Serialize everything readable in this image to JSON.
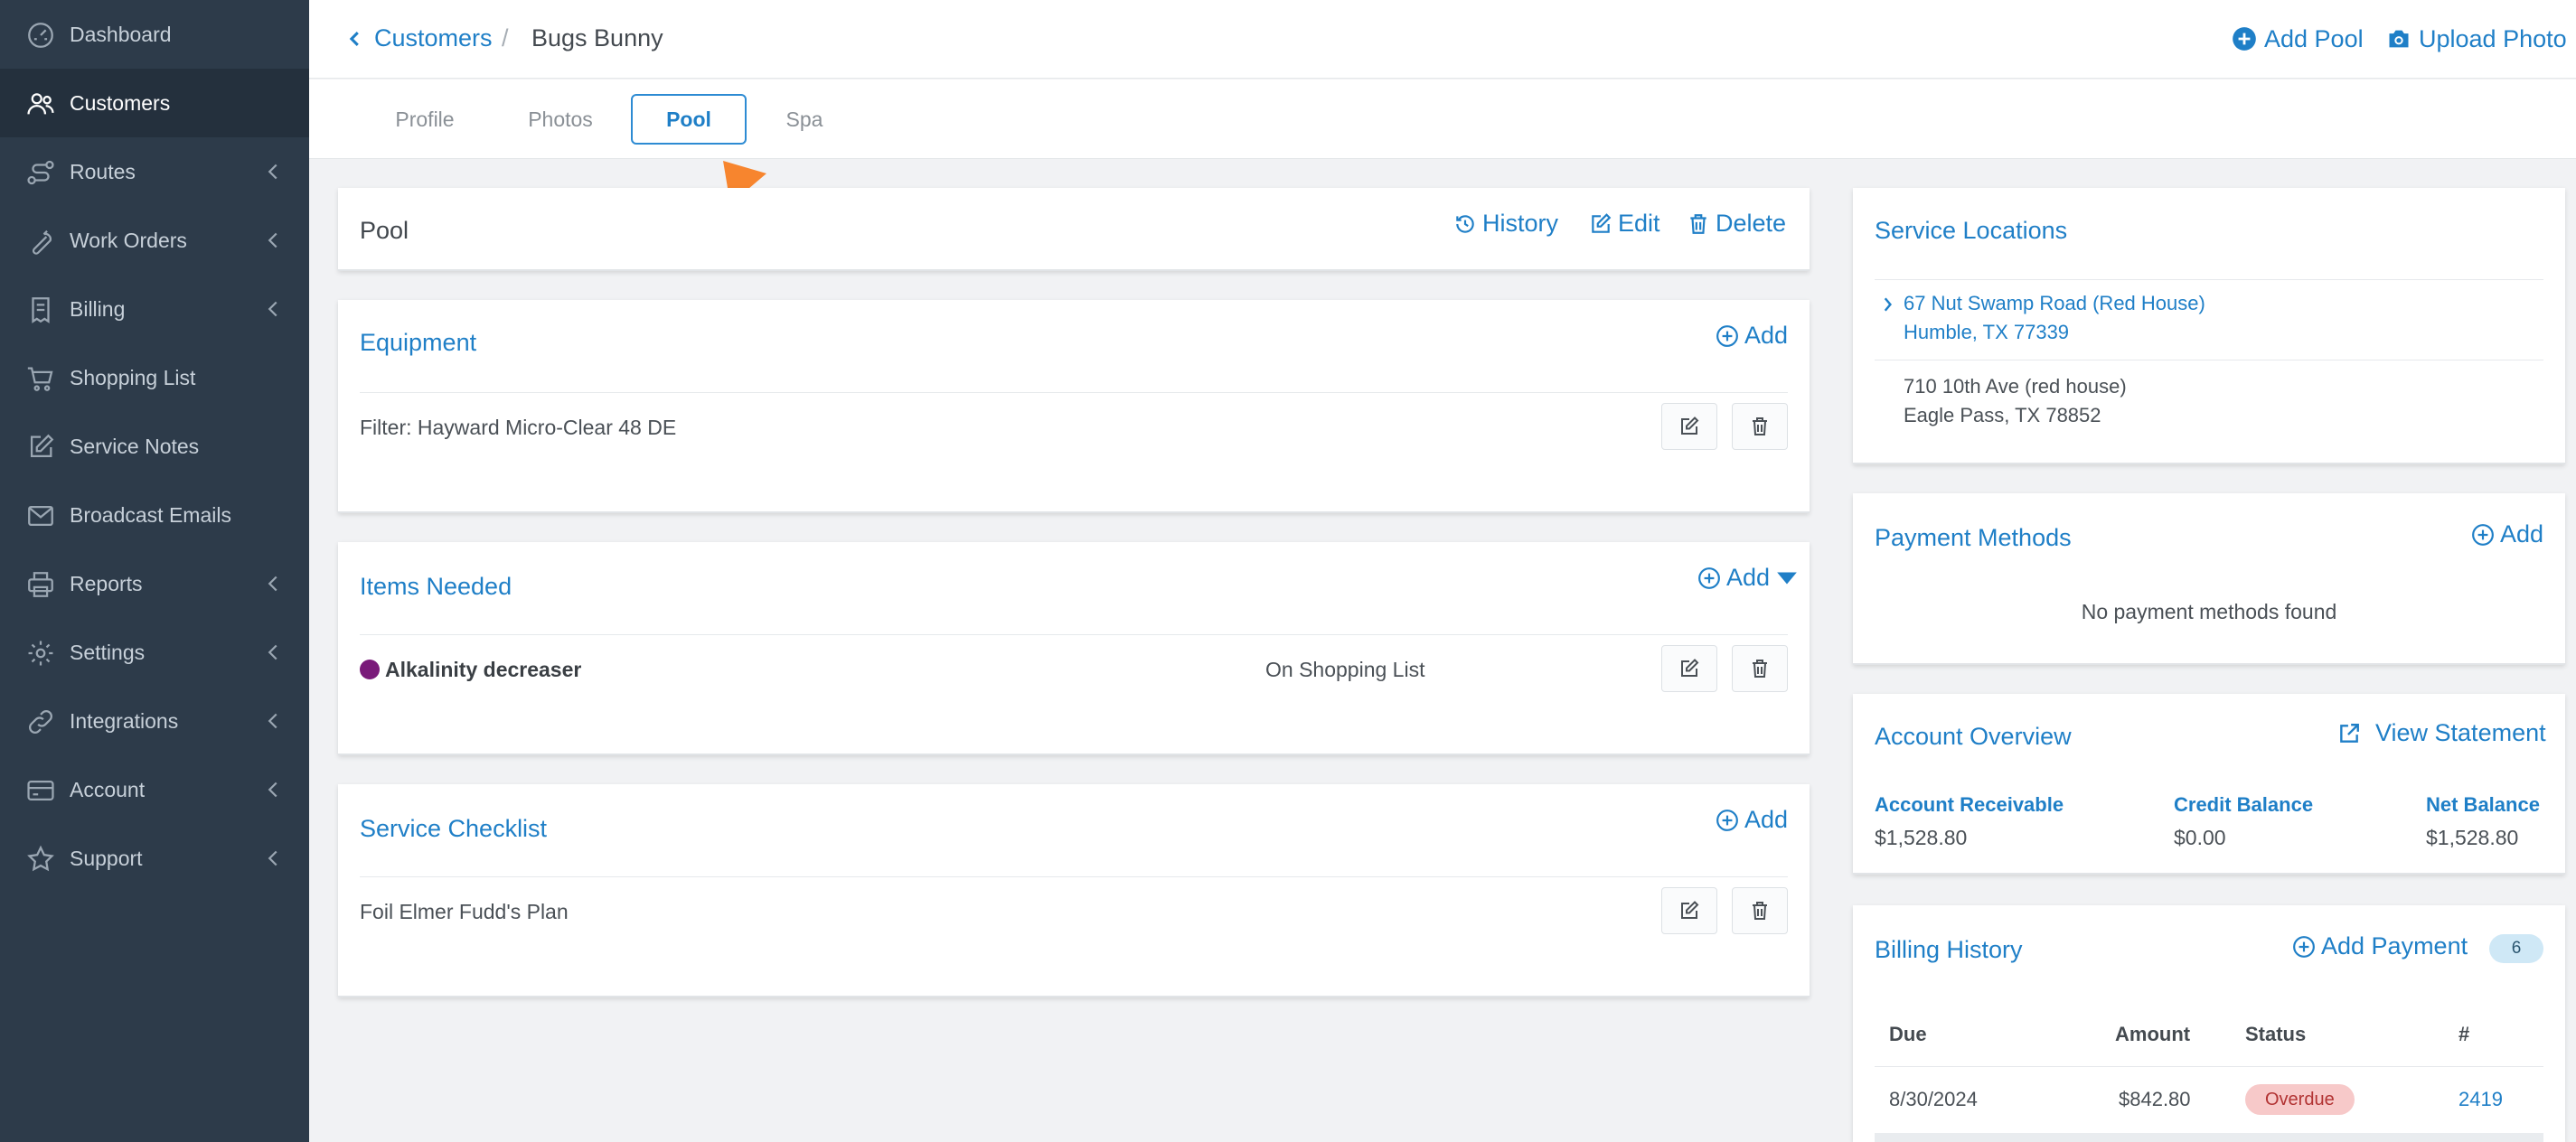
{
  "sidebar": {
    "items": [
      {
        "label": "Dashboard",
        "icon": "dashboard-icon",
        "active": false,
        "has_chevron": false
      },
      {
        "label": "Customers",
        "icon": "users-icon",
        "active": true,
        "has_chevron": false
      },
      {
        "label": "Routes",
        "icon": "route-icon",
        "active": false,
        "has_chevron": true
      },
      {
        "label": "Work Orders",
        "icon": "wrench-icon",
        "active": false,
        "has_chevron": true
      },
      {
        "label": "Billing",
        "icon": "receipt-icon",
        "active": false,
        "has_chevron": true
      },
      {
        "label": "Shopping List",
        "icon": "cart-icon",
        "active": false,
        "has_chevron": false
      },
      {
        "label": "Service Notes",
        "icon": "note-edit-icon",
        "active": false,
        "has_chevron": false
      },
      {
        "label": "Broadcast Emails",
        "icon": "envelope-icon",
        "active": false,
        "has_chevron": false
      },
      {
        "label": "Reports",
        "icon": "printer-icon",
        "active": false,
        "has_chevron": true
      },
      {
        "label": "Settings",
        "icon": "gear-icon",
        "active": false,
        "has_chevron": true
      },
      {
        "label": "Integrations",
        "icon": "link-icon",
        "active": false,
        "has_chevron": true
      },
      {
        "label": "Account",
        "icon": "credit-card-icon",
        "active": false,
        "has_chevron": true
      },
      {
        "label": "Support",
        "icon": "star-icon",
        "active": false,
        "has_chevron": true
      }
    ]
  },
  "header": {
    "breadcrumb_parent": "Customers",
    "breadcrumb_separator": "/",
    "breadcrumb_current": "Bugs Bunny",
    "add_pool_label": "Add Pool",
    "upload_photo_label": "Upload Photo"
  },
  "tabs": [
    {
      "label": "Profile",
      "active": false
    },
    {
      "label": "Photos",
      "active": false
    },
    {
      "label": "Pool",
      "active": true
    },
    {
      "label": "Spa",
      "active": false
    }
  ],
  "pool_card": {
    "title": "Pool",
    "history_label": "History",
    "edit_label": "Edit",
    "delete_label": "Delete"
  },
  "equipment": {
    "title": "Equipment",
    "add_label": "Add",
    "items": [
      "Filter: Hayward Micro-Clear 48 DE"
    ]
  },
  "items_needed": {
    "title": "Items Needed",
    "add_label": "Add",
    "items": [
      {
        "name": "Alkalinity decreaser",
        "status": "On Shopping List",
        "dot_color": "#7a1a7a"
      }
    ]
  },
  "service_checklist": {
    "title": "Service Checklist",
    "add_label": "Add",
    "items": [
      "Foil Elmer Fudd's Plan"
    ]
  },
  "service_locations": {
    "title": "Service Locations",
    "locations": [
      {
        "line1": "67 Nut Swamp Road (Red House)",
        "line2": "Humble, TX 77339",
        "linked": true
      },
      {
        "line1": "710 10th Ave (red house)",
        "line2": "Eagle Pass, TX 78852",
        "linked": false
      }
    ]
  },
  "payment_methods": {
    "title": "Payment Methods",
    "add_label": "Add",
    "empty_text": "No payment methods found"
  },
  "account_overview": {
    "title": "Account Overview",
    "view_statement_label": "View Statement",
    "account_receivable_label": "Account Receivable",
    "account_receivable_value": "$1,528.80",
    "credit_balance_label": "Credit Balance",
    "credit_balance_value": "$0.00",
    "net_balance_label": "Net Balance",
    "net_balance_value": "$1,528.80"
  },
  "billing_history": {
    "title": "Billing History",
    "add_payment_label": "Add Payment",
    "count": "6",
    "columns": [
      "Due",
      "Amount",
      "Status",
      "#"
    ],
    "rows": [
      {
        "due": "8/30/2024",
        "amount": "$842.80",
        "status": "Overdue",
        "number": "2419"
      }
    ]
  },
  "colors": {
    "sidebar_bg": "#2d3b4a",
    "sidebar_active_bg": "#24303d",
    "accent": "#1f7fc7",
    "overdue": "#f7c9c9",
    "annotation_arrow": "#f7852e"
  }
}
